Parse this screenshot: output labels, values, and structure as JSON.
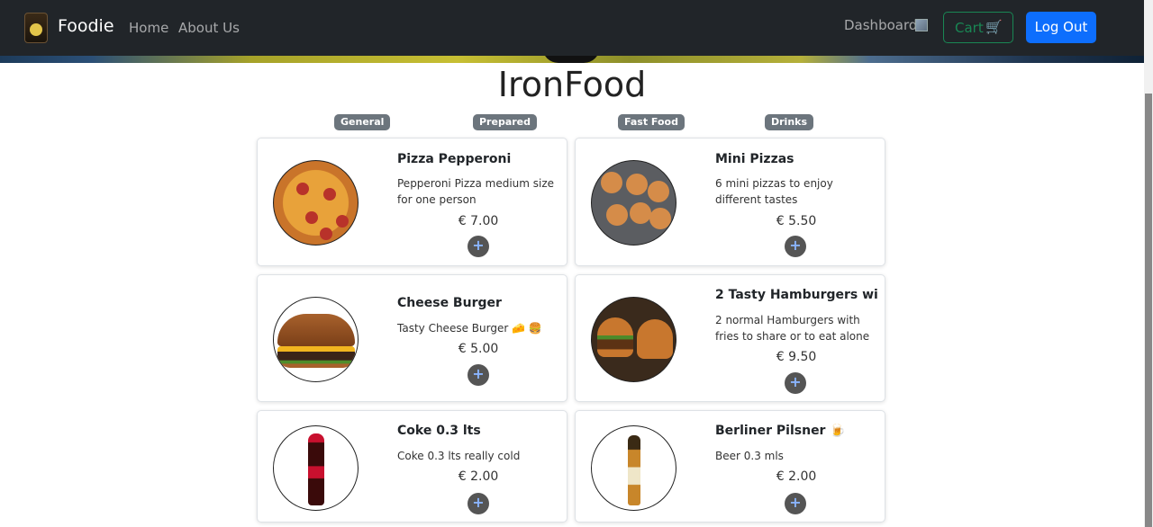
{
  "navbar": {
    "brand": "Foodie",
    "links": [
      "Home",
      "About Us"
    ],
    "dashboard": "Dashboard",
    "cart": "Cart",
    "cart_icon": "🛒",
    "logout": "Log Out"
  },
  "page": {
    "title": "IronFood",
    "categories": [
      "General",
      "Prepared",
      "Fast Food",
      "Drinks"
    ]
  },
  "products": [
    {
      "name": "Pizza Pepperoni",
      "description": "Pepperoni Pizza medium size for one person",
      "price": "€ 7.00",
      "add": "+"
    },
    {
      "name": "Mini Pizzas",
      "description": "6 mini pizzas to enjoy different tastes",
      "price": "€ 5.50",
      "add": "+"
    },
    {
      "name": "Cheese Burger",
      "description": "Tasty Cheese Burger 🧀 🍔",
      "price": "€ 5.00",
      "add": "+"
    },
    {
      "name": "2 Tasty Hamburgers wi",
      "description": "2 normal Hamburgers with fries to share or to eat alone",
      "price": "€ 9.50",
      "add": "+"
    },
    {
      "name": "Coke 0.3 lts",
      "description": "Coke 0.3 lts really cold",
      "price": "€ 2.00",
      "add": "+"
    },
    {
      "name": "Berliner Pilsner 🍺",
      "description": "Beer 0.3 mls",
      "price": "€ 2.00",
      "add": "+"
    }
  ],
  "colors": {
    "navbar_bg": "#212529",
    "primary": "#0d6efd",
    "success": "#198754",
    "badge_bg": "#6c757d"
  }
}
